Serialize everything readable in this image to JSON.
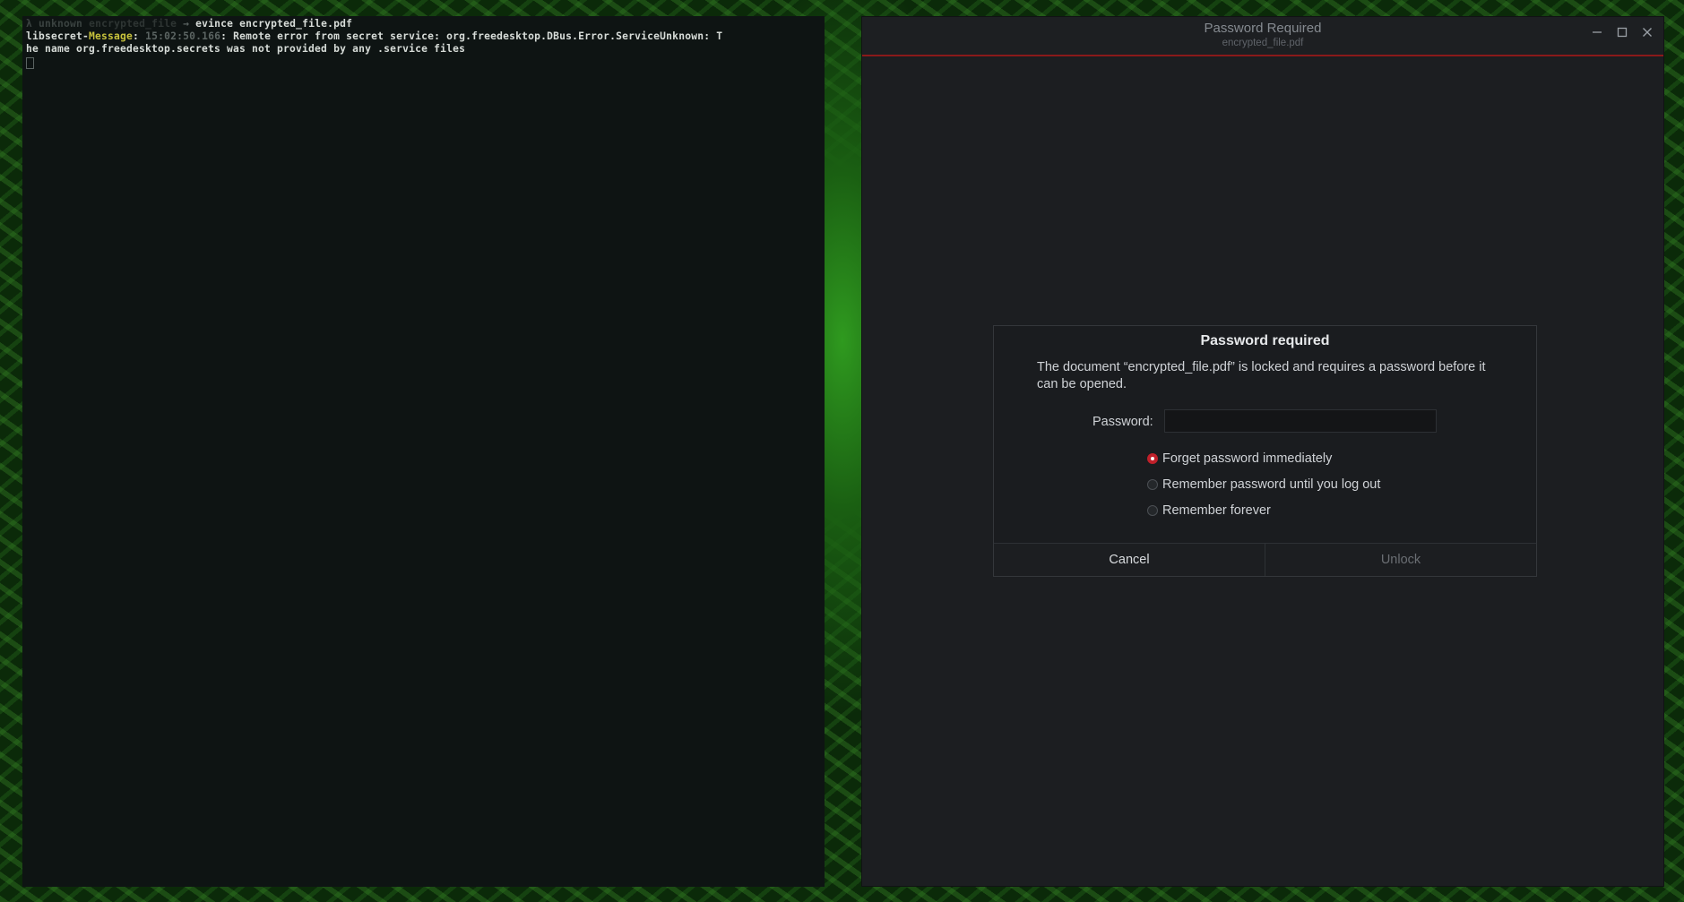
{
  "terminal": {
    "prompt_symbol": "λ",
    "prompt_user": "unknown",
    "prompt_dir": "encrypted_file",
    "prompt_arrow": "→",
    "command": "evince encrypted_file.pdf",
    "msg_source": "libsecret",
    "msg_sep": "-",
    "msg_kind": "Message",
    "msg_colon": ":",
    "msg_time": "15:02:50.166",
    "msg_text_1": ": Remote error from secret service: org.freedesktop.DBus.Error.ServiceUnknown: T",
    "msg_text_2": "he name org.freedesktop.secrets was not provided by any .service files"
  },
  "window": {
    "title": "Password Required",
    "subtitle": "encrypted_file.pdf"
  },
  "dialog": {
    "title": "Password required",
    "message": "The document “encrypted_file.pdf” is locked and requires a password before it can be opened.",
    "password_label": "Password:",
    "password_value": "",
    "options": [
      {
        "label": "Forget password immediately",
        "checked": true
      },
      {
        "label": "Remember password until you log out",
        "checked": false
      },
      {
        "label": "Remember forever",
        "checked": false
      }
    ],
    "cancel_label": "Cancel",
    "unlock_label": "Unlock"
  },
  "colors": {
    "accent": "#c0202a",
    "terminal_bg": "#0e1413",
    "window_bg": "#1c1e21",
    "highlight_yellow": "#c7c23c"
  },
  "icons": {
    "minimize": "minimize-icon",
    "maximize": "maximize-icon",
    "close": "close-icon"
  }
}
